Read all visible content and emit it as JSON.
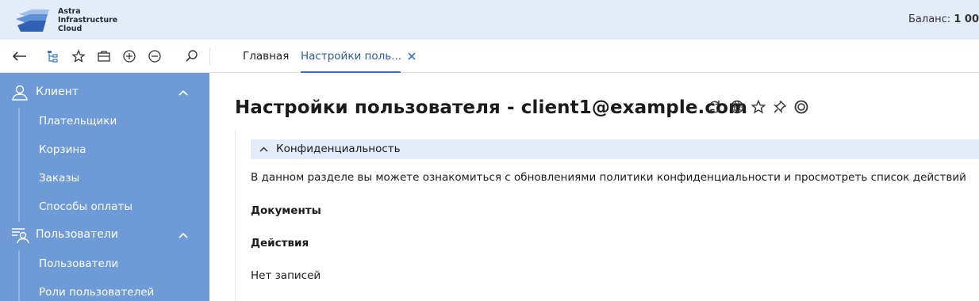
{
  "header": {
    "logo_lines": [
      "Astra",
      "Infrastructure",
      "Cloud"
    ],
    "balance_label": "Баланс:",
    "balance_value": "1 00"
  },
  "toolbar": {
    "icons": [
      "back-arrow-icon",
      "tree-structure-icon",
      "star-icon",
      "briefcase-icon",
      "plus-circle-icon",
      "minus-circle-icon",
      "search-icon"
    ],
    "tabs": [
      {
        "label": "Главная",
        "active": false
      },
      {
        "label": "Настройки поль...",
        "active": true
      }
    ]
  },
  "sidebar": {
    "sections": [
      {
        "label": "Клиент",
        "icon": "user-icon",
        "expanded": true,
        "items": [
          {
            "label": "Плательщики"
          },
          {
            "label": "Корзина"
          },
          {
            "label": "Заказы"
          },
          {
            "label": "Способы оплаты"
          }
        ]
      },
      {
        "label": "Пользователи",
        "icon": "users-list-icon",
        "expanded": true,
        "items": [
          {
            "label": "Пользователи"
          },
          {
            "label": "Роли пользователей"
          }
        ]
      }
    ]
  },
  "main": {
    "title": "Настройки пользователя - client1@example.com",
    "title_icons": [
      "refresh-icon",
      "globe-icon",
      "star-icon",
      "pin-icon",
      "help-ring-icon"
    ],
    "section": {
      "label": "Конфиденциальность",
      "expanded": true,
      "description": "В данном разделе вы можете ознакомиться с обновлениями политики конфиденциальности и просмотреть список действий",
      "documents_heading": "Документы",
      "actions_heading": "Действия",
      "empty_text": "Нет записей"
    }
  },
  "colors": {
    "header_bg": "#e3ecf9",
    "sidebar_bg": "#6e9bd8",
    "accent": "#3d74c4",
    "section_bar_bg": "#e3ecf9"
  }
}
